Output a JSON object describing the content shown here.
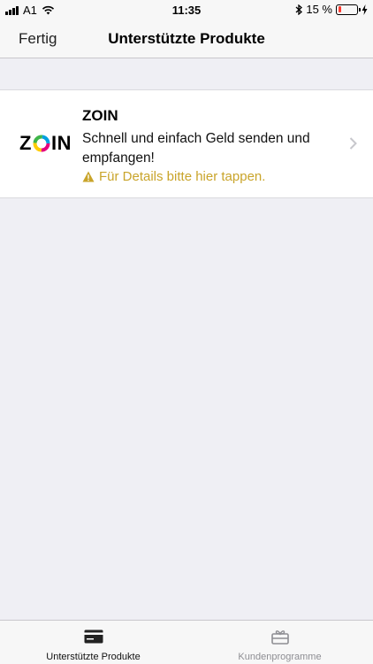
{
  "status_bar": {
    "carrier": "A1",
    "time": "11:35",
    "battery_percent_label": "15 %",
    "battery_level": 0.15,
    "battery_color": "#ff3b30"
  },
  "nav": {
    "done_label": "Fertig",
    "title": "Unterstützte Produkte"
  },
  "products": [
    {
      "logo_text": "ZOIN",
      "name": "ZOIN",
      "description": "Schnell und einfach Geld senden und empfangen!",
      "hint": "Für Details bitte hier tappen.",
      "hint_icon": "warning-icon",
      "hint_color": "#c9a42a"
    }
  ],
  "tab_bar": {
    "tabs": [
      {
        "label": "Unterstützte Produkte",
        "icon": "card-icon",
        "active": true
      },
      {
        "label": "Kundenprogramme",
        "icon": "gift-card-icon",
        "active": false
      }
    ]
  }
}
